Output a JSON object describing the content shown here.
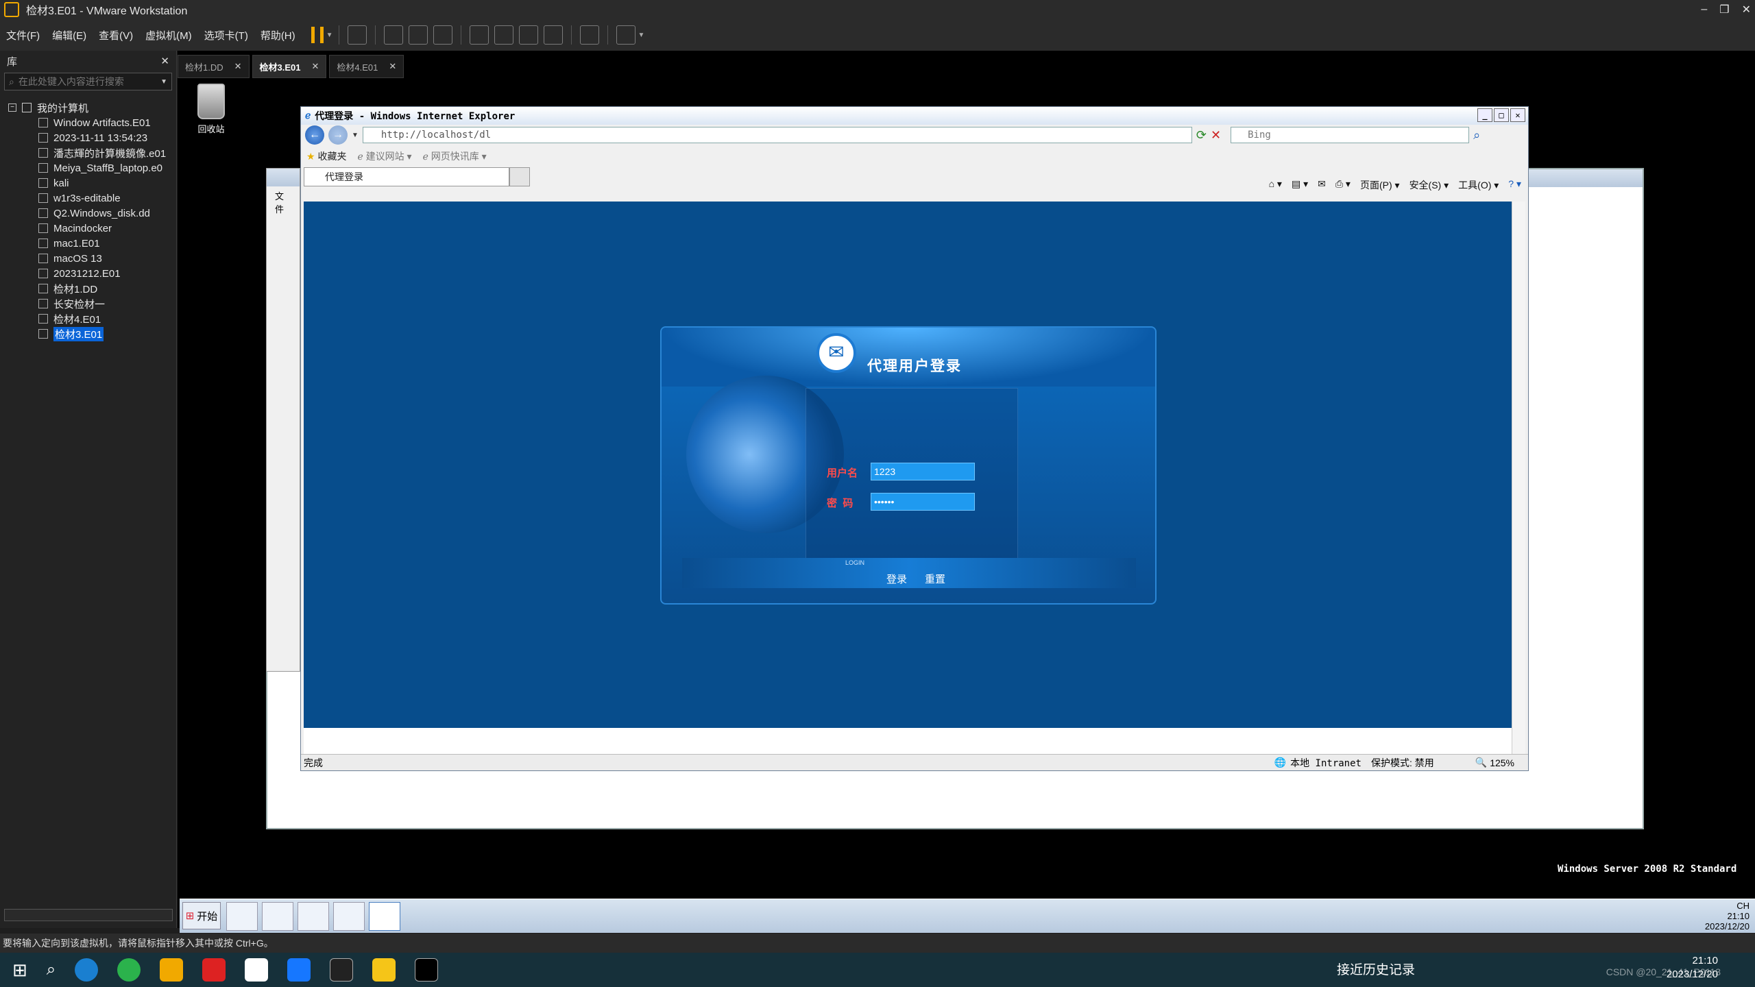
{
  "vmware": {
    "title": "检材3.E01 - VMware Workstation",
    "menus": [
      "文件(F)",
      "编辑(E)",
      "查看(V)",
      "虚拟机(M)",
      "选项卡(T)",
      "帮助(H)"
    ],
    "status_text": "要将输入定向到该虚拟机，请将鼠标指针移入其中或按 Ctrl+G。",
    "accent_color": "#f1a900"
  },
  "library": {
    "title": "库",
    "search_placeholder": "在此处键入内容进行搜索",
    "root": "我的计算机",
    "items": [
      "Window Artifacts.E01",
      "2023-11-11 13:54:23",
      "潘志輝的計算機鏡像.e01",
      "Meiya_StaffB_laptop.e0",
      "kali",
      "w1r3s-editable",
      "Q2.Windows_disk.dd",
      "Macindocker",
      "mac1.E01",
      "macOS 13",
      "20231212.E01",
      "检材1.DD",
      "长安检材一",
      "检材4.E01",
      "检材3.E01"
    ],
    "selected_index": 14
  },
  "vm_tabs": [
    {
      "label": "检材1.DD"
    },
    {
      "label": "检材3.E01",
      "active": true
    },
    {
      "label": "检材4.E01"
    }
  ],
  "desktop": {
    "recycle_bin": "回收站",
    "os_label": "Windows Server 2008 R2 Standard",
    "back_window_text": "文件"
  },
  "ie": {
    "title": "代理登录 - Windows Internet Explorer",
    "url": "http://localhost/dl",
    "search_placeholder": "Bing",
    "favorites": "收藏夹",
    "suggested_sites": "建议网站",
    "web_slice": "网页快讯库",
    "tab_title": "代理登录",
    "cmd_page": "页面(P)",
    "cmd_safety": "安全(S)",
    "cmd_tools": "工具(O)",
    "status_done": "完成",
    "zone": "本地 Intranet",
    "protected_mode": "保护模式: 禁用",
    "zoom": "125%"
  },
  "login": {
    "title": "代理用户登录",
    "username_label": "用户名",
    "password_label": "密  码",
    "username_value": "1223",
    "password_mask": "••••••",
    "caption": "LOGIN",
    "login_button": "登录",
    "reset_button": "重置"
  },
  "guest_taskbar": {
    "start": "开始",
    "time": "21:10",
    "date": "2023/12/20",
    "lang": "CH"
  },
  "host_taskbar": {
    "history": "接近历史记录",
    "time": "21:10",
    "date": "2023/12/20",
    "watermark": "CSDN @20_21_41_P0113"
  }
}
